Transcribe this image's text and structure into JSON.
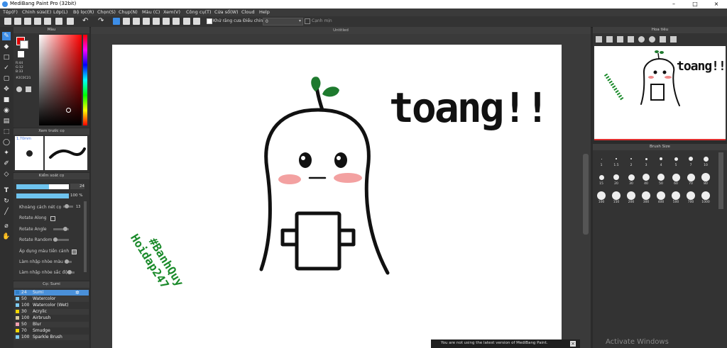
{
  "app": {
    "title": "MediBang Paint Pro (32bit)",
    "minimize": "–",
    "maximize": "□",
    "close": "×"
  },
  "menu": [
    "Tệp(F)",
    "Chỉnh sửa(E)",
    "Lớp(L)",
    "Bộ lọc(R)",
    "Chọn(S)",
    "Chụp(N)",
    "Màu (C)",
    "Xem(V)",
    "Công cụ(T)",
    "Cửa sổ(W)",
    "Cloud",
    "Help"
  ],
  "toolbar": {
    "antialias_label": "Khử răng cưa",
    "adjust_label": "Điều chỉnh",
    "adjust_value": "0",
    "edge_label": "Cạnh mịn"
  },
  "canvas_tab": "Untitled",
  "color_panel": {
    "title": "Màu",
    "r": "R:44",
    "g": "G:12",
    "b": "B:33",
    "hex": "#2C0C21",
    "fg_color": "#e00000",
    "bg_color": "#000000"
  },
  "brush_preview": {
    "title": "Xem trước cọ",
    "size_label": "1.70mm"
  },
  "brush_control": {
    "title": "Kiểm soát cọ",
    "size_value": "24",
    "opacity_value": "100 %",
    "options": [
      {
        "label": "Khoảng cách nét cọ",
        "value": "13"
      },
      {
        "label": "Rotate Along"
      },
      {
        "label": "Rotate Angle"
      },
      {
        "label": "Rotate Random"
      },
      {
        "label": "Áp dụng màu tiền cảnh"
      },
      {
        "label": "Làm nhập nhòe màu"
      },
      {
        "label": "Làm nhập nhòe sắc độ"
      }
    ]
  },
  "brush_list": {
    "title": "Cọ: Sumi",
    "items": [
      {
        "size": "24",
        "name": "Sumi",
        "color": "#2f7fc7"
      },
      {
        "size": "50",
        "name": "Watercolor",
        "color": "#7ecbf2"
      },
      {
        "size": "100",
        "name": "Watercolor (Wet)",
        "color": "#7ecbf2"
      },
      {
        "size": "30",
        "name": "Acrylic",
        "color": "#f2d600"
      },
      {
        "size": "100",
        "name": "Airbrush",
        "color": "#d8c9a0"
      },
      {
        "size": "50",
        "name": "Blur",
        "color": "#f0a0b0"
      },
      {
        "size": "70",
        "name": "Smudge",
        "color": "#f2d600"
      },
      {
        "size": "100",
        "name": "Sparkle Brush",
        "color": "#7ecbf2"
      }
    ]
  },
  "navigator": {
    "title": "Hoa tiêu"
  },
  "brush_size": {
    "title": "Brush Size",
    "rows": [
      [
        "1",
        "1.5",
        "2",
        "3",
        "4",
        "5",
        "7",
        "10"
      ],
      [
        "15",
        "20",
        "30",
        "40",
        "50",
        "60",
        "70",
        "80"
      ],
      [
        "100",
        "150",
        "200",
        "300",
        "400",
        "500",
        "700",
        "1000"
      ]
    ]
  },
  "drawing": {
    "text_main": "toang!!",
    "text_side_1": "#BanhQuy",
    "text_side_2": "Hoidap247",
    "text_side_color": "#1a8a2a",
    "sprout_color": "#1e7a2e",
    "cheek_color": "#f08a8a"
  },
  "notification": {
    "text": "You are not using the latest version of MediBang Paint.",
    "close": "×"
  },
  "watermark": "Activate Windows"
}
